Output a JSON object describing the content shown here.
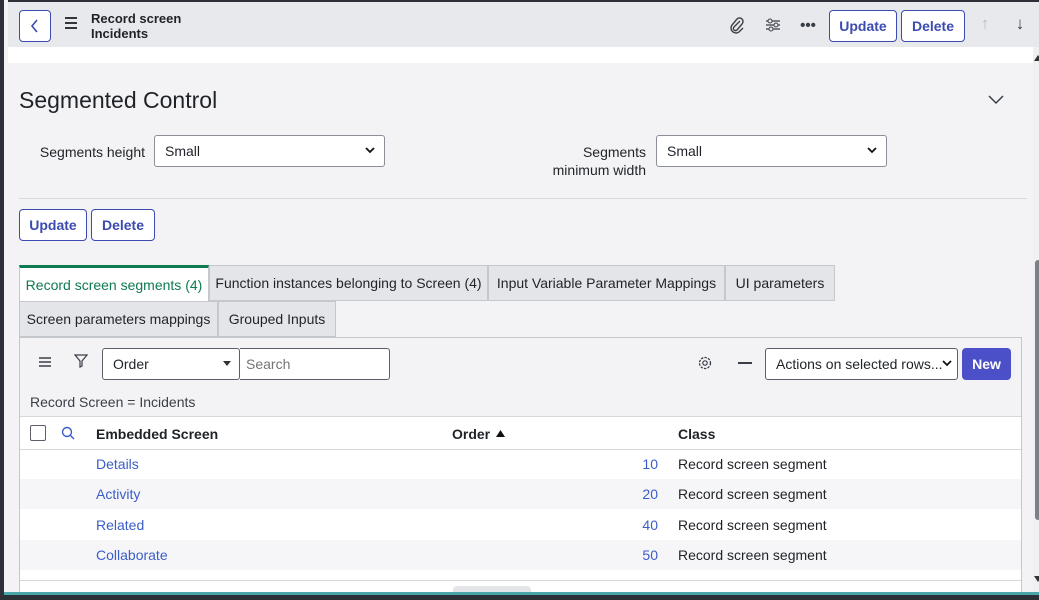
{
  "header": {
    "title_line1": "Record screen",
    "title_line2": "Incidents",
    "update_label": "Update",
    "delete_label": "Delete"
  },
  "section": {
    "title": "Segmented Control",
    "fields": [
      {
        "label": "Segments height",
        "value": "Small"
      },
      {
        "label_line1": "Segments",
        "label_line2": "minimum width",
        "value": "Small"
      }
    ],
    "update_label": "Update",
    "delete_label": "Delete"
  },
  "tabs": [
    {
      "label": "Record screen segments (4)",
      "active": true
    },
    {
      "label": "Function instances belonging to Screen (4)"
    },
    {
      "label": "Input Variable Parameter Mappings"
    },
    {
      "label": "UI parameters"
    },
    {
      "label": "Screen parameters mappings"
    },
    {
      "label": "Grouped Inputs"
    }
  ],
  "list": {
    "search_field": "Order",
    "search_placeholder": "Search",
    "actions_select": "Actions on selected rows...",
    "new_label": "New",
    "filter_text": "Record Screen = Incidents",
    "columns": [
      "Embedded Screen",
      "Order",
      "Class"
    ],
    "rows": [
      {
        "embedded": "Details",
        "order": "10",
        "class": "Record screen segment"
      },
      {
        "embedded": "Activity",
        "order": "20",
        "class": "Record screen segment"
      },
      {
        "embedded": "Related",
        "order": "40",
        "class": "Record screen segment"
      },
      {
        "embedded": "Collaborate",
        "order": "50",
        "class": "Record screen segment"
      }
    ]
  },
  "colors": {
    "accent": "#3b4bb0",
    "active_tab": "#0e7a4f",
    "link": "#3b5dc9",
    "new_button": "#4c50c8"
  }
}
